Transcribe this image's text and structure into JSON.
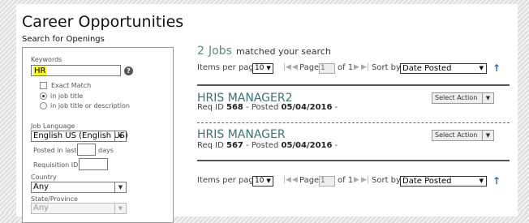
{
  "page": {
    "title": "Career Opportunities",
    "subtitle": "Search for Openings"
  },
  "search": {
    "keywords_label": "Keywords",
    "keywords_value": "HR",
    "exact_match_label": "Exact Match",
    "in_job_title_label": "in job title",
    "in_job_title_or_description_label": "in job title or description",
    "selected_scope": "in job title",
    "job_language_label": "Job Language",
    "job_language_value": "English US (English US)",
    "posted_in_last_label": "Posted in last:",
    "posted_in_last_value": "",
    "days_label": "days",
    "requisition_id_label": "Requisition ID:",
    "requisition_id_value": "",
    "country_label": "Country",
    "country_value": "Any",
    "state_label": "State/Province",
    "state_value": "Any"
  },
  "results": {
    "count": "2",
    "count_word": "Jobs",
    "count_suffix": "matched your search",
    "pager": {
      "items_per_page_label": "Items per page",
      "items_per_page_value": "10",
      "page_label": "Page",
      "page_value": "1",
      "of_label": "of 1",
      "sort_by_label": "Sort by:",
      "sort_by_value": "Date Posted"
    },
    "jobs": [
      {
        "title": "HRIS MANAGER2",
        "req_label": "Req ID",
        "req_id": "568",
        "posted_label": "- Posted",
        "posted_date": "05/04/2016",
        "trailing": "-",
        "action_label": "Select Action"
      },
      {
        "title": "HRIS MANAGER",
        "req_label": "Req ID",
        "req_id": "567",
        "posted_label": "- Posted",
        "posted_date": "05/04/2016",
        "trailing": "-",
        "action_label": "Select Action"
      }
    ]
  },
  "colors": {
    "accent_teal": "#3f6f75",
    "highlight_yellow": "#f6f631",
    "sort_arrow_blue": "#2b6aa8"
  },
  "icons": {
    "help": "help-icon",
    "first_page": "first-page-icon",
    "prev_page": "prev-page-icon",
    "next_page": "next-page-icon",
    "last_page": "last-page-icon",
    "sort_direction": "sort-ascending-icon",
    "dropdown": "chevron-down-icon"
  }
}
